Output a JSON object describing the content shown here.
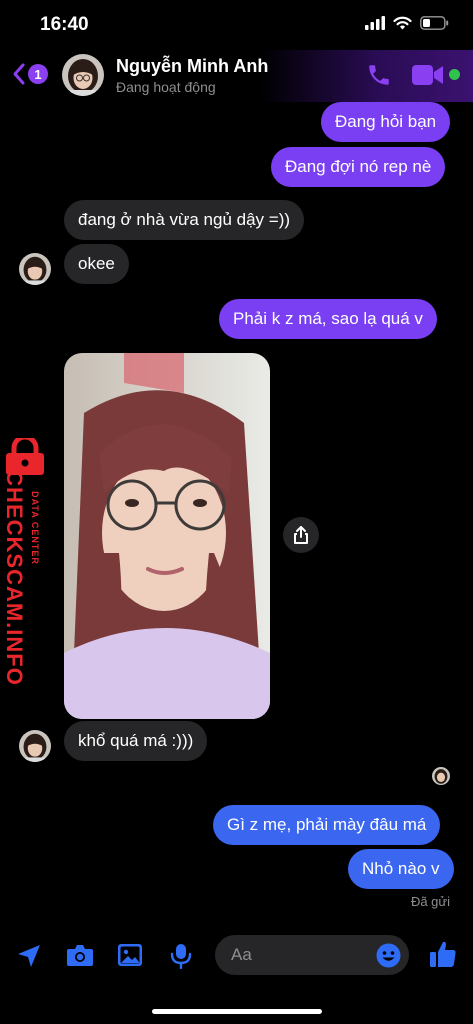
{
  "status_bar": {
    "time": "16:40"
  },
  "header": {
    "unread_count": "1",
    "contact_name": "Nguyễn Minh Anh",
    "contact_status": "Đang hoạt động"
  },
  "messages": [
    {
      "text": "Đang hỏi bạn",
      "direction": "outgoing"
    },
    {
      "text": "Đang đợi nó rep nè",
      "direction": "outgoing"
    },
    {
      "text": "đang ở nhà vừa ngủ dậy =))",
      "direction": "incoming"
    },
    {
      "text": "okee",
      "direction": "incoming"
    },
    {
      "text": "Phải k z má,  sao lạ quá v",
      "direction": "outgoing"
    },
    {
      "text": "khổ quá má :)))",
      "direction": "incoming"
    },
    {
      "text": "Gì z mẹ, phải mày đâu má",
      "direction": "outgoing"
    },
    {
      "text": "Nhỏ nào v",
      "direction": "outgoing"
    }
  ],
  "photo": {
    "description_icon": "selfie-photo"
  },
  "watermark": {
    "main": "CHECKSCAM.INFO",
    "sub": "DATA CENTER"
  },
  "sent_status": "Đã gửi",
  "composer": {
    "placeholder": "Aa"
  },
  "colors": {
    "outgoing_purple": "#7a3ff2",
    "outgoing_blue": "#3b66f0",
    "incoming": "#262628",
    "accent": "#8a3ff0",
    "composer_blue": "#2e6cf6",
    "online": "#31c24d",
    "watermark_red": "#e8262b"
  }
}
